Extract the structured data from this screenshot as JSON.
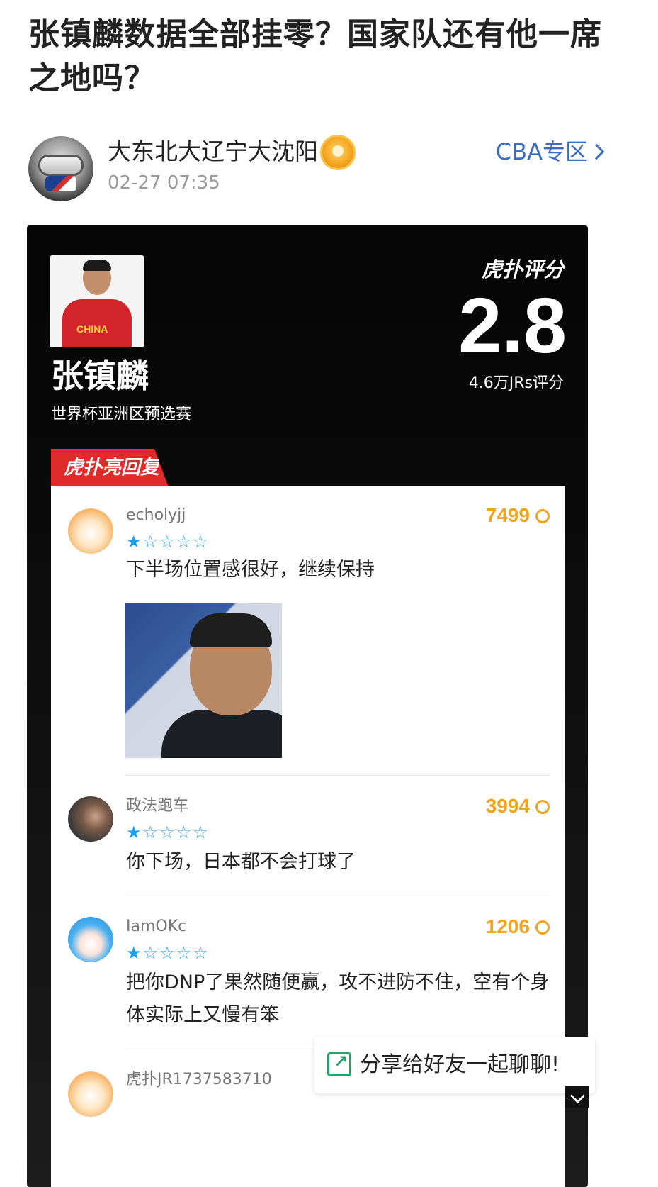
{
  "article": {
    "title": "张镇麟数据全部挂零？国家队还有他一席之地吗？"
  },
  "author": {
    "name": "大东北大辽宁大沈阳",
    "time": "02-27 07:35",
    "avatar_icon": "helmet-avatar-icon",
    "badge_icon": "achievement-badge-icon"
  },
  "section": {
    "label": "CBA专区",
    "icon": "chevron-right-icon",
    "color": "#3a6cc0"
  },
  "card": {
    "player_name": "张镇麟",
    "event": "世界杯亚洲区预选赛",
    "jersey_text": "CHINA",
    "rating_brand": "虎扑评分",
    "score": "2.8",
    "rating_count": "4.6万JRs评分",
    "highlight_label": "虎扑亮回复",
    "highlight_color": "#e02b2b"
  },
  "comments": [
    {
      "user": "echolyjj",
      "likes": "7499",
      "stars": 1,
      "stars_text_on": "★",
      "stars_text_off": "☆☆☆☆",
      "text": "下半场位置感很好，继续保持",
      "has_image": true
    },
    {
      "user": "政法跑车",
      "likes": "3994",
      "stars": 1,
      "stars_text_on": "★",
      "stars_text_off": "☆☆☆☆",
      "text": "你下场，日本都不会打球了"
    },
    {
      "user": "IamOKc",
      "likes": "1206",
      "stars": 1,
      "stars_text_on": "★",
      "stars_text_off": "☆☆☆☆",
      "text": "把你DNP了果然随便赢，攻不进防不住，空有个身体实际上又慢有笨"
    },
    {
      "user": "虎扑JR1737583710"
    }
  ],
  "share": {
    "label": "分享给好友一起聊聊!",
    "icon": "share-icon",
    "color": "#21a366"
  },
  "colors": {
    "likes": "#f0a520",
    "stars": "#1a9ef5"
  }
}
